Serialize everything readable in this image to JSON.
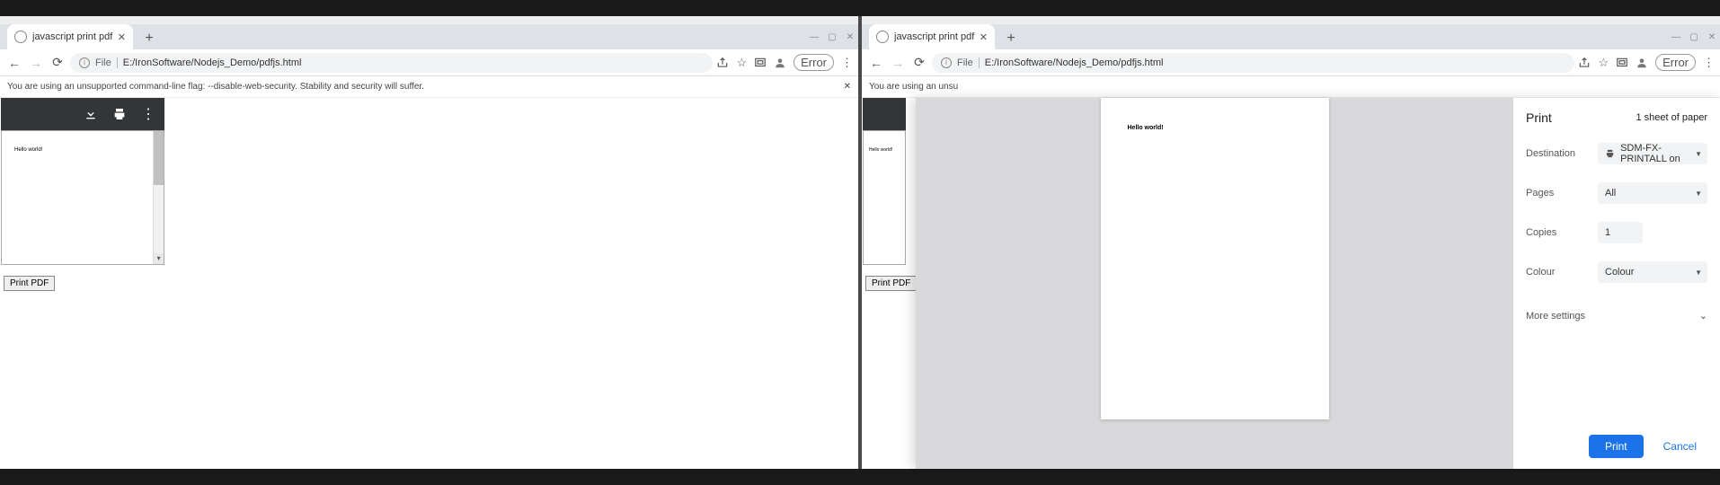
{
  "left": {
    "tab_title": "javascript print pdf",
    "url_scheme": "File",
    "url_path": "E:/IronSoftware/Nodejs_Demo/pdfjs.html",
    "warning": "You are using an unsupported command-line flag: --disable-web-security. Stability and security will suffer.",
    "error_label": "Error",
    "pdf_text": "Hello world!",
    "print_btn": "Print PDF"
  },
  "right": {
    "tab_title": "javascript print pdf",
    "url_scheme": "File",
    "url_path": "E:/IronSoftware/Nodejs_Demo/pdfjs.html",
    "warning_partial": "You are using an unsu",
    "error_label": "Error",
    "pdf_text": "Hello world!",
    "print_btn": "Print PDF"
  },
  "print": {
    "title": "Print",
    "sheet_count": "1 sheet of paper",
    "labels": {
      "destination": "Destination",
      "pages": "Pages",
      "copies": "Copies",
      "colour": "Colour",
      "more": "More settings"
    },
    "values": {
      "destination": "SDM-FX-PRINTALL on",
      "pages": "All",
      "copies": "1",
      "colour": "Colour"
    },
    "preview_text": "Hello world!",
    "buttons": {
      "print": "Print",
      "cancel": "Cancel"
    }
  }
}
